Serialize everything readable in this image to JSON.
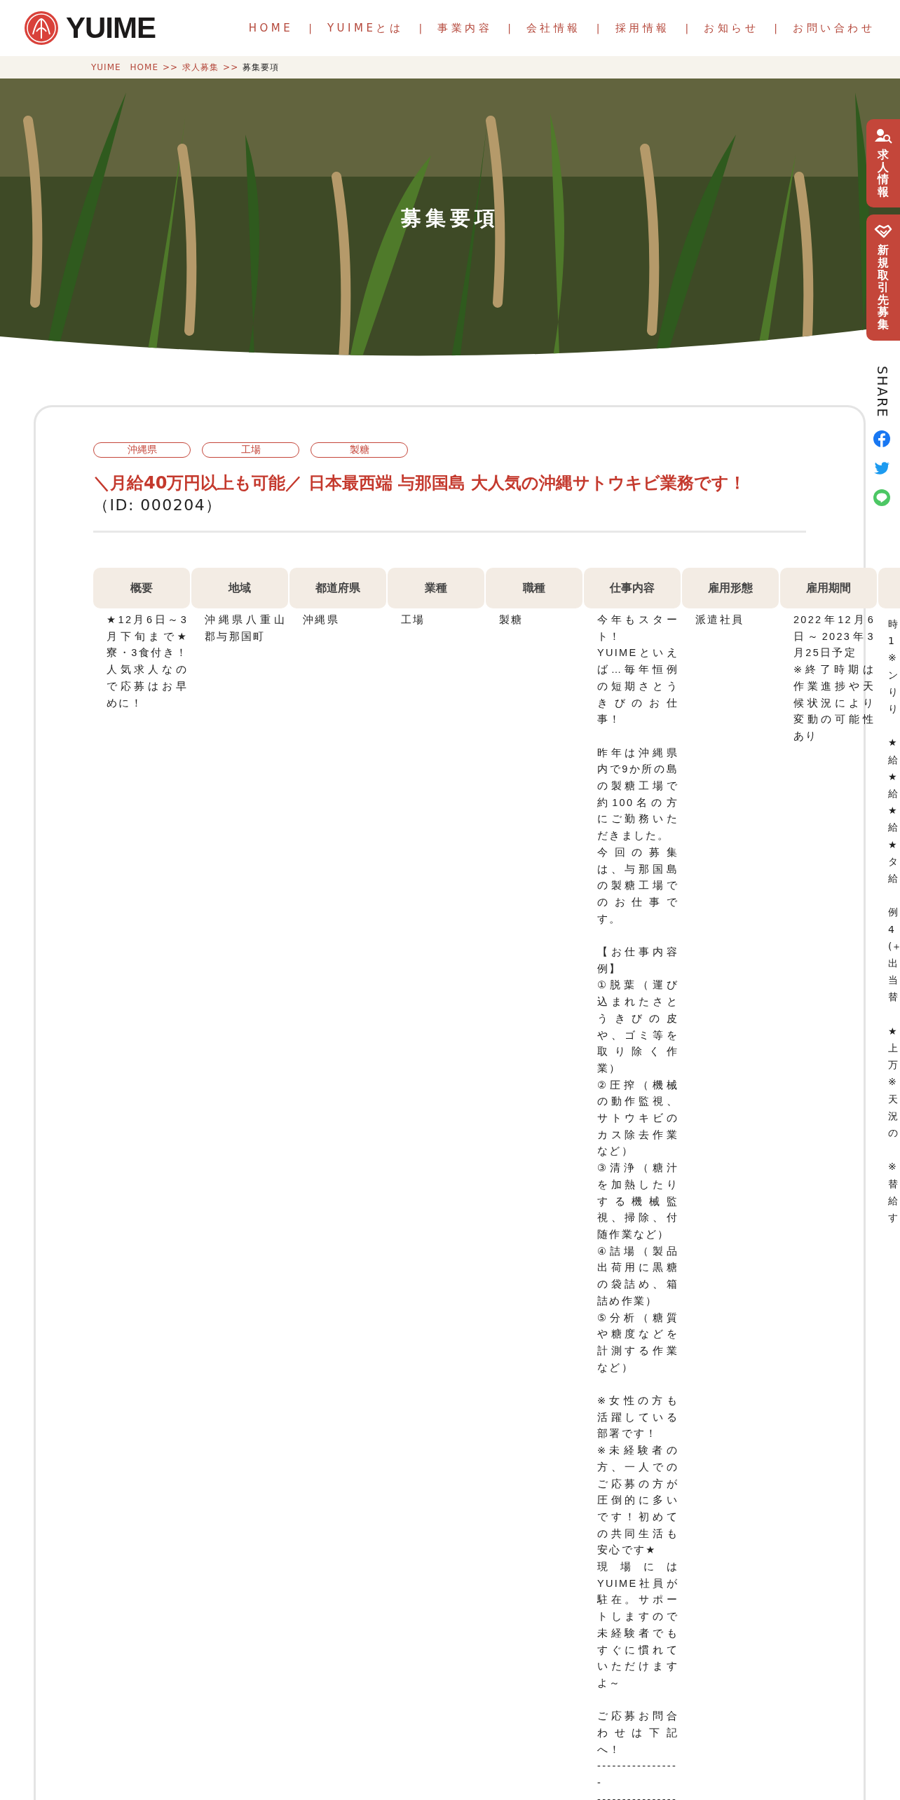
{
  "header": {
    "logo": "YUIME",
    "nav": [
      {
        "kind": "link",
        "label": "HOME"
      },
      {
        "kind": "separator",
        "label": "|"
      },
      {
        "kind": "link",
        "label": "YUIMEとは"
      },
      {
        "kind": "separator",
        "label": "|"
      },
      {
        "kind": "link",
        "label": "事業内容"
      },
      {
        "kind": "separator",
        "label": "|"
      },
      {
        "kind": "link",
        "label": "会社情報"
      },
      {
        "kind": "separator",
        "label": "|"
      },
      {
        "kind": "link",
        "label": "採用情報"
      },
      {
        "kind": "separator",
        "label": "|"
      },
      {
        "kind": "link",
        "label": "お知らせ"
      },
      {
        "kind": "separator",
        "label": "|"
      },
      {
        "kind": "link",
        "label": "お問い合わせ"
      }
    ]
  },
  "breadcrumb": [
    {
      "kind": "link",
      "label": "YUIME　HOME"
    },
    {
      "kind": "separator",
      "label": ">>"
    },
    {
      "kind": "link",
      "label": "求人募集"
    },
    {
      "kind": "separator",
      "label": ">>"
    },
    {
      "kind": "current",
      "label": "募集要項"
    }
  ],
  "hero": {
    "kind": "picture",
    "title": "募集要項"
  },
  "side_tabs": [
    {
      "label": "求人情報"
    },
    {
      "label": "新規取引先募集"
    }
  ],
  "share": {
    "label": "SHARE"
  },
  "job": {
    "tags": [
      "沖縄県",
      "工場",
      "製糖"
    ],
    "title": "＼月給40万円以上も可能／ 日本最西端 与那国島 大人気の沖縄サトウキビ業務です！",
    "id": "（ID: 000204）",
    "table": {
      "columns": [
        "概要",
        "地域",
        "都道府県",
        "業種",
        "職種",
        "仕事内容",
        "雇用形態",
        "雇用期間"
      ],
      "rows": [
        {
          "cells": [
            [
              [
                "★12月6日～3月下旬まで★寮・3食付き！人気求人なので応募はお早めに！"
              ]
            ],
            [
              [
                "沖縄県八重山郡与那国町"
              ]
            ],
            [
              [
                "沖縄県"
              ]
            ],
            [
              [
                "工場"
              ]
            ],
            [
              [
                "製糖"
              ]
            ],
            [
              [
                "今年もスタート！",
                "YUIMEといえば…毎年恒例の短期さとうきびのお仕事！"
              ],
              [
                "昨年は沖縄県内で9か所の島の製糖工場で約100名の方にご勤務いただきました。",
                "今回の募集は、与那国島の製糖工場でのお仕事です。"
              ],
              [
                "【お仕事内容例】",
                "①脱葉（運び込まれたさとうきびの皮や、ゴミ等を取り除く作業）",
                "②圧搾（機械の動作監視、サトウキビのカス除去作業など）",
                "③清浄（糖汁を加熱したりする機械監視、掃除、付随作業など）",
                "④詰場（製品出荷用に黒糖の袋詰め、箱詰め作業）",
                "⑤分析（糖質や糖度などを計測する作業など）"
              ],
              [
                "※女性の方も活躍している部署です！",
                "※未経験者の方、一人でのご応募の方が圧倒的に多いです！初めての共同生活も安心です★",
                "現場にはYUIME社員が駐在。サポートしますので未経験者でもすぐに慣れていただけますよ～"
              ],
              [
                "ご応募お問合わせは下記へ！",
                "-----------------",
                "-----------------"
              ]
            ],
            [
              [
                "派遣社員"
              ]
            ],
            [
              [
                "2022年12月6日～2023年3月25日予定",
                "※終了時期は作業進捗や天候状況により変動の可能性あり"
              ]
            ]
          ],
          "cut_cells": [
            "時1※ンりり",
            "★給★給★給★タ給",
            "例4(＋出当替",
            "★上万※天況の",
            "※替給す"
          ]
        }
      ]
    }
  }
}
